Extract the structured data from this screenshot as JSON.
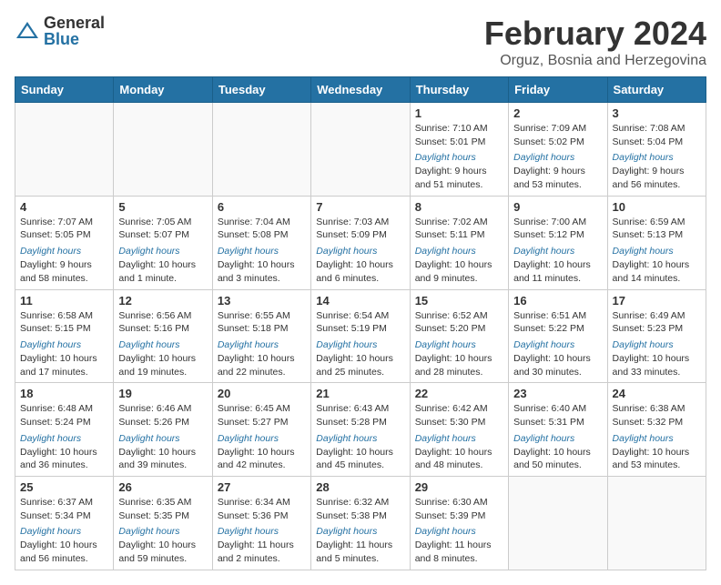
{
  "logo": {
    "general": "General",
    "blue": "Blue"
  },
  "title": "February 2024",
  "subtitle": "Orguz, Bosnia and Herzegovina",
  "days_of_week": [
    "Sunday",
    "Monday",
    "Tuesday",
    "Wednesday",
    "Thursday",
    "Friday",
    "Saturday"
  ],
  "weeks": [
    [
      {
        "day": "",
        "sunrise": "",
        "sunset": "",
        "daylight": ""
      },
      {
        "day": "",
        "sunrise": "",
        "sunset": "",
        "daylight": ""
      },
      {
        "day": "",
        "sunrise": "",
        "sunset": "",
        "daylight": ""
      },
      {
        "day": "",
        "sunrise": "",
        "sunset": "",
        "daylight": ""
      },
      {
        "day": "1",
        "sunrise": "Sunrise: 7:10 AM",
        "sunset": "Sunset: 5:01 PM",
        "daylight": "Daylight: 9 hours and 51 minutes."
      },
      {
        "day": "2",
        "sunrise": "Sunrise: 7:09 AM",
        "sunset": "Sunset: 5:02 PM",
        "daylight": "Daylight: 9 hours and 53 minutes."
      },
      {
        "day": "3",
        "sunrise": "Sunrise: 7:08 AM",
        "sunset": "Sunset: 5:04 PM",
        "daylight": "Daylight: 9 hours and 56 minutes."
      }
    ],
    [
      {
        "day": "4",
        "sunrise": "Sunrise: 7:07 AM",
        "sunset": "Sunset: 5:05 PM",
        "daylight": "Daylight: 9 hours and 58 minutes."
      },
      {
        "day": "5",
        "sunrise": "Sunrise: 7:05 AM",
        "sunset": "Sunset: 5:07 PM",
        "daylight": "Daylight: 10 hours and 1 minute."
      },
      {
        "day": "6",
        "sunrise": "Sunrise: 7:04 AM",
        "sunset": "Sunset: 5:08 PM",
        "daylight": "Daylight: 10 hours and 3 minutes."
      },
      {
        "day": "7",
        "sunrise": "Sunrise: 7:03 AM",
        "sunset": "Sunset: 5:09 PM",
        "daylight": "Daylight: 10 hours and 6 minutes."
      },
      {
        "day": "8",
        "sunrise": "Sunrise: 7:02 AM",
        "sunset": "Sunset: 5:11 PM",
        "daylight": "Daylight: 10 hours and 9 minutes."
      },
      {
        "day": "9",
        "sunrise": "Sunrise: 7:00 AM",
        "sunset": "Sunset: 5:12 PM",
        "daylight": "Daylight: 10 hours and 11 minutes."
      },
      {
        "day": "10",
        "sunrise": "Sunrise: 6:59 AM",
        "sunset": "Sunset: 5:13 PM",
        "daylight": "Daylight: 10 hours and 14 minutes."
      }
    ],
    [
      {
        "day": "11",
        "sunrise": "Sunrise: 6:58 AM",
        "sunset": "Sunset: 5:15 PM",
        "daylight": "Daylight: 10 hours and 17 minutes."
      },
      {
        "day": "12",
        "sunrise": "Sunrise: 6:56 AM",
        "sunset": "Sunset: 5:16 PM",
        "daylight": "Daylight: 10 hours and 19 minutes."
      },
      {
        "day": "13",
        "sunrise": "Sunrise: 6:55 AM",
        "sunset": "Sunset: 5:18 PM",
        "daylight": "Daylight: 10 hours and 22 minutes."
      },
      {
        "day": "14",
        "sunrise": "Sunrise: 6:54 AM",
        "sunset": "Sunset: 5:19 PM",
        "daylight": "Daylight: 10 hours and 25 minutes."
      },
      {
        "day": "15",
        "sunrise": "Sunrise: 6:52 AM",
        "sunset": "Sunset: 5:20 PM",
        "daylight": "Daylight: 10 hours and 28 minutes."
      },
      {
        "day": "16",
        "sunrise": "Sunrise: 6:51 AM",
        "sunset": "Sunset: 5:22 PM",
        "daylight": "Daylight: 10 hours and 30 minutes."
      },
      {
        "day": "17",
        "sunrise": "Sunrise: 6:49 AM",
        "sunset": "Sunset: 5:23 PM",
        "daylight": "Daylight: 10 hours and 33 minutes."
      }
    ],
    [
      {
        "day": "18",
        "sunrise": "Sunrise: 6:48 AM",
        "sunset": "Sunset: 5:24 PM",
        "daylight": "Daylight: 10 hours and 36 minutes."
      },
      {
        "day": "19",
        "sunrise": "Sunrise: 6:46 AM",
        "sunset": "Sunset: 5:26 PM",
        "daylight": "Daylight: 10 hours and 39 minutes."
      },
      {
        "day": "20",
        "sunrise": "Sunrise: 6:45 AM",
        "sunset": "Sunset: 5:27 PM",
        "daylight": "Daylight: 10 hours and 42 minutes."
      },
      {
        "day": "21",
        "sunrise": "Sunrise: 6:43 AM",
        "sunset": "Sunset: 5:28 PM",
        "daylight": "Daylight: 10 hours and 45 minutes."
      },
      {
        "day": "22",
        "sunrise": "Sunrise: 6:42 AM",
        "sunset": "Sunset: 5:30 PM",
        "daylight": "Daylight: 10 hours and 48 minutes."
      },
      {
        "day": "23",
        "sunrise": "Sunrise: 6:40 AM",
        "sunset": "Sunset: 5:31 PM",
        "daylight": "Daylight: 10 hours and 50 minutes."
      },
      {
        "day": "24",
        "sunrise": "Sunrise: 6:38 AM",
        "sunset": "Sunset: 5:32 PM",
        "daylight": "Daylight: 10 hours and 53 minutes."
      }
    ],
    [
      {
        "day": "25",
        "sunrise": "Sunrise: 6:37 AM",
        "sunset": "Sunset: 5:34 PM",
        "daylight": "Daylight: 10 hours and 56 minutes."
      },
      {
        "day": "26",
        "sunrise": "Sunrise: 6:35 AM",
        "sunset": "Sunset: 5:35 PM",
        "daylight": "Daylight: 10 hours and 59 minutes."
      },
      {
        "day": "27",
        "sunrise": "Sunrise: 6:34 AM",
        "sunset": "Sunset: 5:36 PM",
        "daylight": "Daylight: 11 hours and 2 minutes."
      },
      {
        "day": "28",
        "sunrise": "Sunrise: 6:32 AM",
        "sunset": "Sunset: 5:38 PM",
        "daylight": "Daylight: 11 hours and 5 minutes."
      },
      {
        "day": "29",
        "sunrise": "Sunrise: 6:30 AM",
        "sunset": "Sunset: 5:39 PM",
        "daylight": "Daylight: 11 hours and 8 minutes."
      },
      {
        "day": "",
        "sunrise": "",
        "sunset": "",
        "daylight": ""
      },
      {
        "day": "",
        "sunrise": "",
        "sunset": "",
        "daylight": ""
      }
    ]
  ]
}
